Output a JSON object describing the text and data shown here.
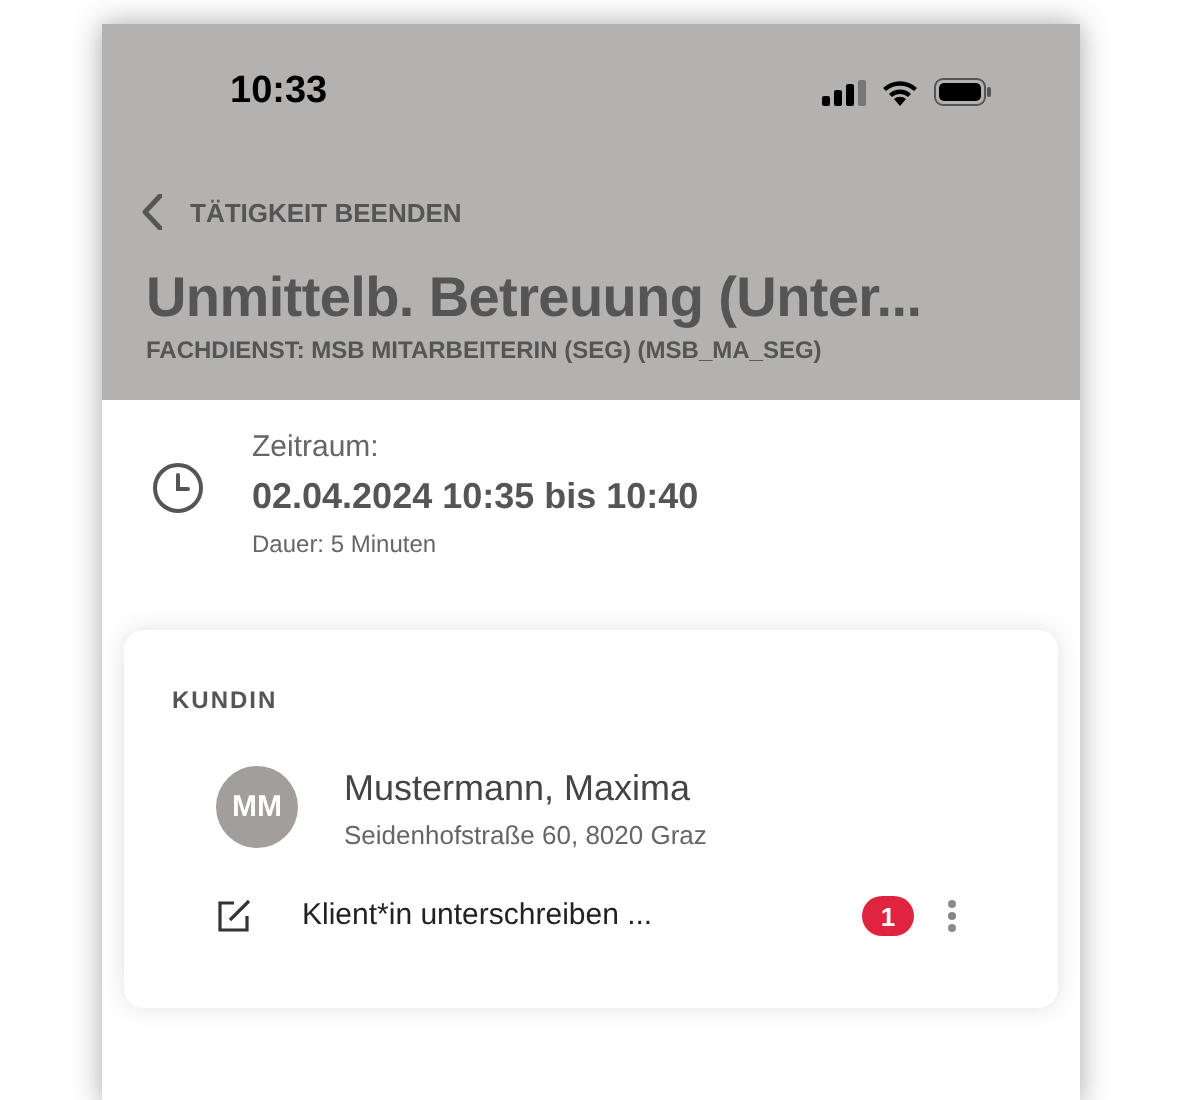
{
  "status_bar": {
    "time": "10:33"
  },
  "header": {
    "back_label": "TÄTIGKEIT BEENDEN",
    "title": "Unmittelb. Betreuung (Unter...",
    "subtitle": "FACHDIENST: MSB MITARBEITERIN (SEG) (MSB_MA_SEG)"
  },
  "period": {
    "label": "Zeitraum:",
    "value": "02.04.2024 10:35 bis 10:40",
    "duration": "Dauer: 5 Minuten"
  },
  "client_card": {
    "heading": "KUNDIN",
    "avatar": "MM",
    "name": "Mustermann, Maxima",
    "address": "Seidenhofstraße 60, 8020 Graz",
    "tasks": [
      {
        "label": "Klient*in unterschreiben ...",
        "badge": "1"
      }
    ]
  }
}
